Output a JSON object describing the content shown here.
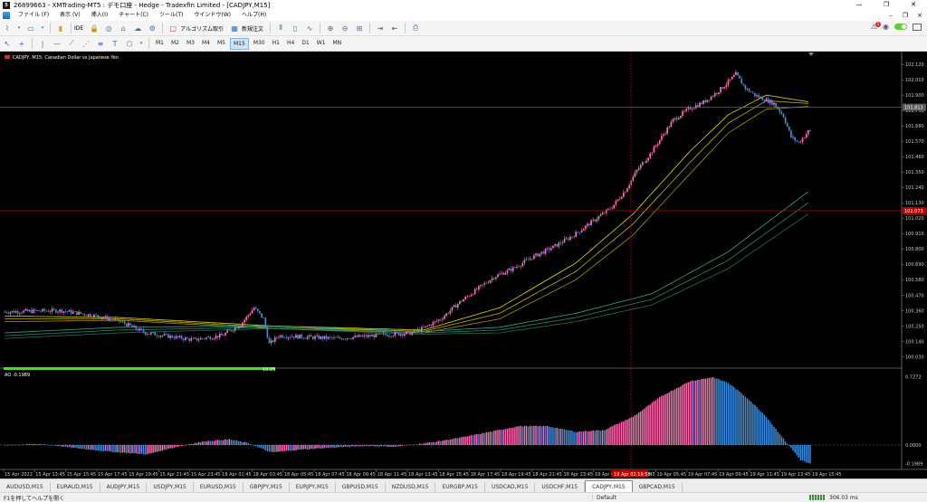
{
  "window": {
    "title": "26899663 - XMTrading-MT5 : デモ口座 - Hedge - Tradexfin Limited - [CADJPY,M15]",
    "controls": [
      "—",
      "❐",
      "✕"
    ]
  },
  "menu": [
    "ファイル (F)",
    "表示 (V)",
    "挿入(I)",
    "チャート(C)",
    "ツール(T)",
    "ウインドウ(W)",
    "ヘルプ(H)"
  ],
  "toolbar": {
    "ide_label": "IDE",
    "algo_label": "アルゴリズム取引",
    "neworder_label": "新規注文",
    "notification_count": "1"
  },
  "timeframes": [
    "M1",
    "M2",
    "M3",
    "M4",
    "M5",
    "M15",
    "M30",
    "H1",
    "H4",
    "D1",
    "W1",
    "MN"
  ],
  "active_timeframe": "M15",
  "chart": {
    "symbol_label": "CADJPY, M15:  Canadian Dollar vs Japanese Yen",
    "ao_label": "AO -0.1989",
    "cursor_time_label": "10:25",
    "crosshair_price_tag": "101.073",
    "current_price_tag": "101.813",
    "crosshair_time_tag": "19 Apr 02:19:58",
    "colors": {
      "bull": "#ff6eb0",
      "bear": "#3a8fe0",
      "crosshair": "#c00000",
      "ma_yellow": "#d4c400",
      "ma_green": "#2c9a7a",
      "bar_green": "#5ec84a"
    }
  },
  "chart_data": {
    "type": "candlestick",
    "symbol": "CADJPY",
    "timeframe": "M15",
    "price_axis_ticks": [
      "102.120",
      "102.010",
      "101.900",
      "101.790",
      "101.680",
      "101.570",
      "101.460",
      "101.350",
      "101.240",
      "101.130",
      "101.020",
      "100.910",
      "100.800",
      "100.690",
      "100.580",
      "100.470",
      "100.360",
      "100.250",
      "100.140",
      "100.030"
    ],
    "ao_axis_ticks": [
      "0.7272",
      "0.0000",
      "-0.1989"
    ],
    "time_axis_labels": [
      "15 Apr 2022",
      "15 Apr 13:45",
      "15 Apr 15:45",
      "15 Apr 17:45",
      "15 Apr 19:45",
      "15 Apr 21:45",
      "15 Apr 23:45",
      "18 Apr 01:45",
      "18 Apr 03:45",
      "18 Apr 05:45",
      "18 Apr 07:45",
      "18 Apr 09:45",
      "18 Apr 11:45",
      "18 Apr 13:45",
      "18 Apr 15:45",
      "18 Apr 17:45",
      "18 Apr 19:45",
      "18 Apr 21:45",
      "18 Apr 23:45",
      "19 Apr 01:45",
      "19 Apr 03:45",
      "19 Apr 05:45",
      "19 Apr 07:45",
      "19 Apr 09:45",
      "19 Apr 11:45",
      "19 Apr 13:45",
      "19 Apr 15:45"
    ],
    "y_range": [
      99.98,
      102.16
    ],
    "ao_range": [
      -0.26,
      0.74
    ],
    "keypoints": [
      [
        0,
        100.35
      ],
      [
        30,
        100.36
      ],
      [
        50,
        100.32
      ],
      [
        62,
        100.28
      ],
      [
        75,
        100.2
      ],
      [
        85,
        100.18
      ],
      [
        100,
        100.15
      ],
      [
        115,
        100.18
      ],
      [
        125,
        100.26
      ],
      [
        132,
        100.38
      ],
      [
        137,
        100.3
      ],
      [
        140,
        100.12
      ],
      [
        145,
        100.18
      ],
      [
        160,
        100.17
      ],
      [
        175,
        100.16
      ],
      [
        195,
        100.18
      ],
      [
        215,
        100.2
      ],
      [
        222,
        100.24
      ],
      [
        230,
        100.3
      ],
      [
        240,
        100.42
      ],
      [
        250,
        100.52
      ],
      [
        258,
        100.6
      ],
      [
        268,
        100.66
      ],
      [
        278,
        100.74
      ],
      [
        290,
        100.82
      ],
      [
        300,
        100.9
      ],
      [
        312,
        101.02
      ],
      [
        320,
        101.1
      ],
      [
        327,
        101.22
      ],
      [
        333,
        101.36
      ],
      [
        340,
        101.48
      ],
      [
        346,
        101.6
      ],
      [
        352,
        101.72
      ],
      [
        360,
        101.8
      ],
      [
        368,
        101.85
      ],
      [
        375,
        101.92
      ],
      [
        380,
        101.98
      ],
      [
        385,
        102.05
      ],
      [
        390,
        101.95
      ],
      [
        395,
        101.9
      ],
      [
        405,
        101.84
      ],
      [
        410,
        101.75
      ],
      [
        414,
        101.6
      ],
      [
        418,
        101.56
      ],
      [
        423,
        101.64
      ]
    ],
    "ao_keypoints": [
      [
        0,
        0.0
      ],
      [
        20,
        0.01
      ],
      [
        40,
        -0.04
      ],
      [
        60,
        -0.08
      ],
      [
        75,
        -0.1
      ],
      [
        90,
        -0.02
      ],
      [
        105,
        0.04
      ],
      [
        118,
        0.06
      ],
      [
        128,
        0.02
      ],
      [
        140,
        -0.08
      ],
      [
        155,
        -0.05
      ],
      [
        170,
        -0.03
      ],
      [
        190,
        -0.01
      ],
      [
        205,
        -0.02
      ],
      [
        225,
        0.03
      ],
      [
        240,
        0.08
      ],
      [
        255,
        0.14
      ],
      [
        270,
        0.2
      ],
      [
        285,
        0.2
      ],
      [
        300,
        0.14
      ],
      [
        315,
        0.16
      ],
      [
        330,
        0.3
      ],
      [
        345,
        0.52
      ],
      [
        360,
        0.68
      ],
      [
        372,
        0.72
      ],
      [
        380,
        0.66
      ],
      [
        390,
        0.5
      ],
      [
        400,
        0.3
      ],
      [
        410,
        0.04
      ],
      [
        418,
        -0.16
      ],
      [
        423,
        -0.2
      ]
    ],
    "moving_averages": [
      {
        "color": "#e8d800",
        "points": [
          [
            0,
            100.32
          ],
          [
            60,
            100.31
          ],
          [
            140,
            100.25
          ],
          [
            220,
            100.22
          ],
          [
            260,
            100.38
          ],
          [
            300,
            100.7
          ],
          [
            330,
            101.05
          ],
          [
            360,
            101.5
          ],
          [
            380,
            101.76
          ],
          [
            400,
            101.9
          ],
          [
            423,
            101.85
          ]
        ]
      },
      {
        "color": "#c8b400",
        "points": [
          [
            0,
            100.3
          ],
          [
            60,
            100.3
          ],
          [
            140,
            100.24
          ],
          [
            220,
            100.21
          ],
          [
            260,
            100.34
          ],
          [
            300,
            100.64
          ],
          [
            330,
            100.98
          ],
          [
            360,
            101.42
          ],
          [
            380,
            101.7
          ],
          [
            400,
            101.86
          ],
          [
            423,
            101.84
          ]
        ]
      },
      {
        "color": "#a89400",
        "points": [
          [
            0,
            100.28
          ],
          [
            60,
            100.29
          ],
          [
            140,
            100.23
          ],
          [
            220,
            100.2
          ],
          [
            260,
            100.3
          ],
          [
            300,
            100.58
          ],
          [
            330,
            100.9
          ],
          [
            360,
            101.34
          ],
          [
            380,
            101.63
          ],
          [
            400,
            101.8
          ],
          [
            423,
            101.82
          ]
        ]
      },
      {
        "color": "#2fa88a",
        "points": [
          [
            0,
            100.2
          ],
          [
            60,
            100.24
          ],
          [
            140,
            100.25
          ],
          [
            220,
            100.21
          ],
          [
            260,
            100.24
          ],
          [
            300,
            100.34
          ],
          [
            340,
            100.48
          ],
          [
            380,
            100.78
          ],
          [
            423,
            101.22
          ]
        ]
      },
      {
        "color": "#238a70",
        "points": [
          [
            0,
            100.18
          ],
          [
            60,
            100.22
          ],
          [
            140,
            100.24
          ],
          [
            220,
            100.2
          ],
          [
            260,
            100.22
          ],
          [
            300,
            100.31
          ],
          [
            340,
            100.44
          ],
          [
            380,
            100.72
          ],
          [
            423,
            101.14
          ]
        ]
      },
      {
        "color": "#1c7060",
        "points": [
          [
            0,
            100.16
          ],
          [
            60,
            100.2
          ],
          [
            140,
            100.23
          ],
          [
            220,
            100.19
          ],
          [
            260,
            100.2
          ],
          [
            300,
            100.28
          ],
          [
            340,
            100.4
          ],
          [
            380,
            100.66
          ],
          [
            423,
            101.06
          ]
        ]
      }
    ],
    "candle_count": 424
  },
  "tabs": [
    "AUDUSD,M15",
    "EURAUD,M15",
    "AUDJPY,M15",
    "USDJPY,M15",
    "EURUSD,M15",
    "GBPJPY,M15",
    "EURJPY,M15",
    "GBPUSD,M15",
    "NZDUSD,M15",
    "EURGBP,M15",
    "USDCAD,M15",
    "USDCHF,M15",
    "CADJPY,M15",
    "GBPCAD,M15"
  ],
  "active_tab": "CADJPY,M15",
  "status": {
    "hint": "F1を押してヘルプを開く",
    "profile": "Default",
    "ping": "306.03 ms"
  }
}
